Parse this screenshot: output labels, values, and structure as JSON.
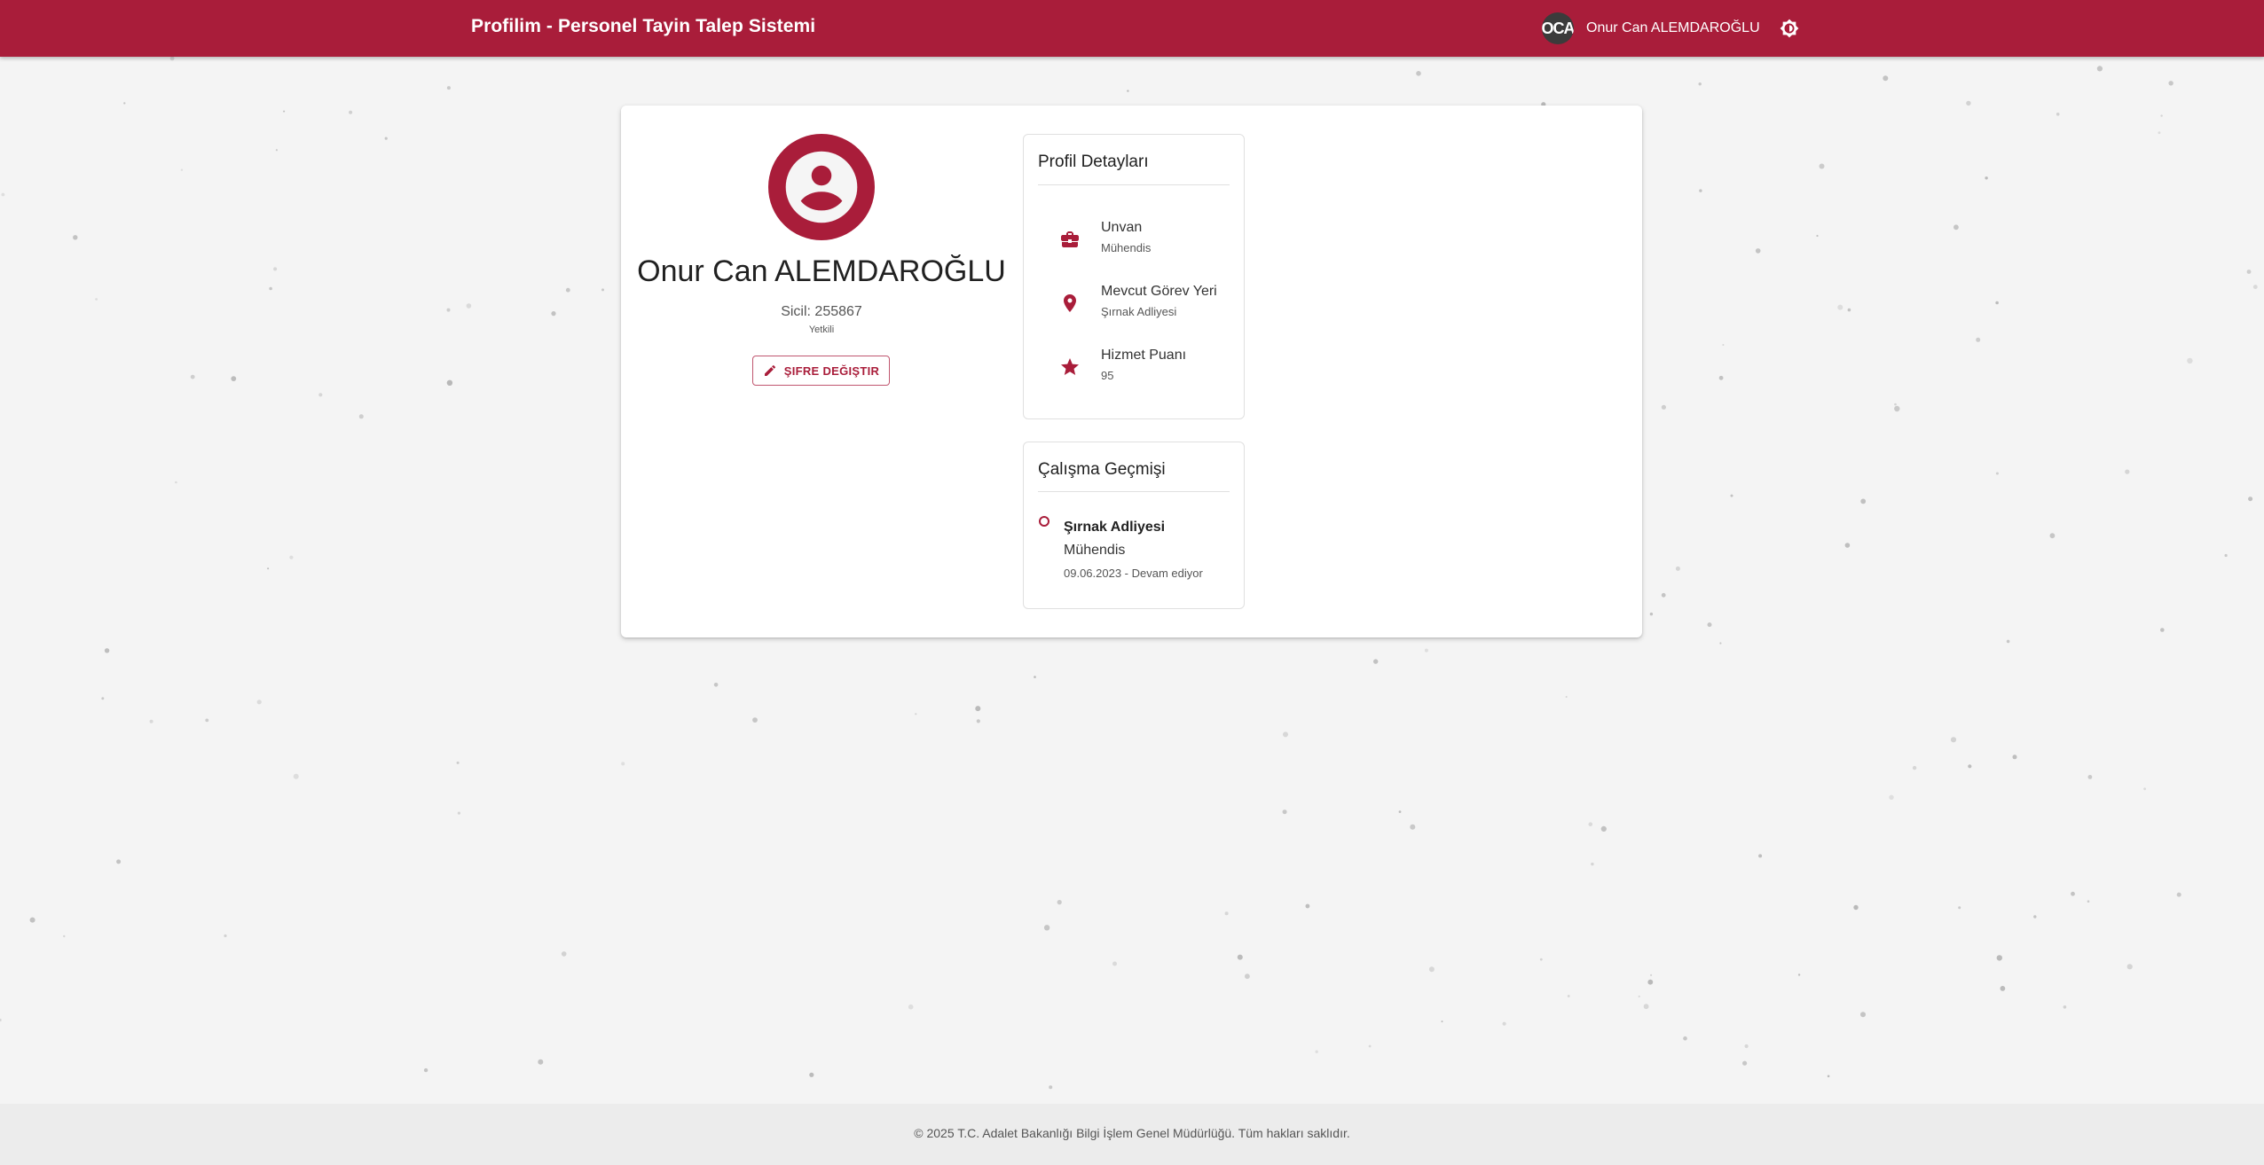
{
  "header": {
    "title": "Profilim - Personel Tayin Talep Sistemi",
    "user_initials": "OCA",
    "user_name": "Onur Can ALEMDAROĞLU",
    "theme_icon": "brightness-icon"
  },
  "profile": {
    "name": "Onur Can ALEMDAROĞLU",
    "sicil": "Sicil: 255867",
    "role": "Yetkili",
    "change_password_label": "ŞIFRE DEĞIŞTIR"
  },
  "details": {
    "title": "Profil Detayları",
    "items": [
      {
        "label": "Unvan",
        "value": "Mühendis",
        "icon": "briefcase-icon"
      },
      {
        "label": "Mevcut Görev Yeri",
        "value": "Şırnak Adliyesi",
        "icon": "location-pin-icon"
      },
      {
        "label": "Hizmet Puanı",
        "value": "95",
        "icon": "star-icon"
      }
    ]
  },
  "history": {
    "title": "Çalışma Geçmişi",
    "entries": [
      {
        "place": "Şırnak Adliyesi",
        "role": "Mühendis",
        "dates": "09.06.2023 - Devam ediyor"
      }
    ]
  },
  "footer": {
    "text": "© 2025 T.C. Adalet Bakanlığı Bilgi İşlem Genel Müdürlüğü. Tüm hakları saklıdır."
  },
  "colors": {
    "primary": "#a91d3a",
    "background": "#f4f4f4",
    "card": "#ffffff"
  }
}
